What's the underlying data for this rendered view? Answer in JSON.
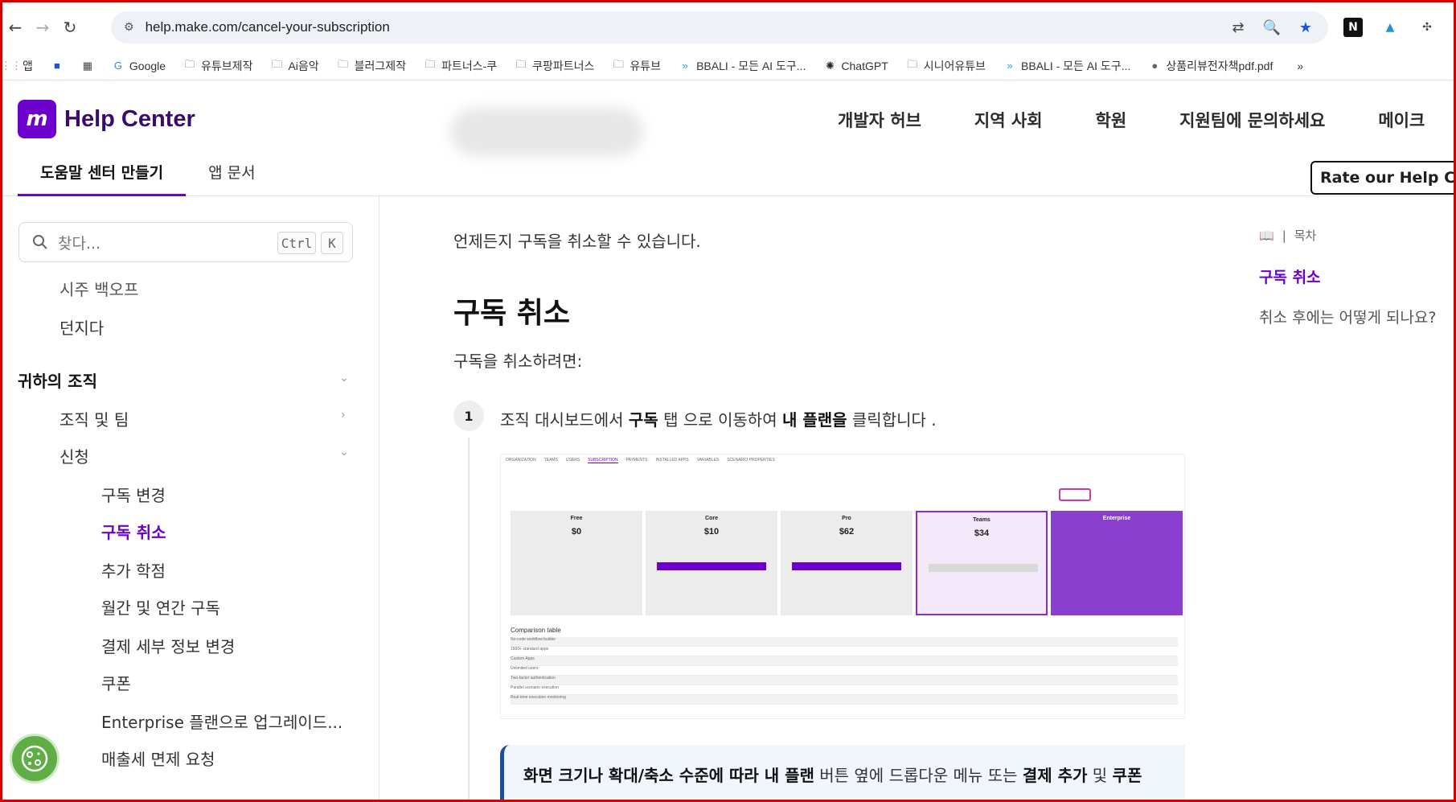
{
  "browser": {
    "url": "help.make.com/cancel-your-subscription",
    "bookmarks": [
      {
        "label": "앱",
        "icon": "apps-grid-icon"
      },
      {
        "label": "",
        "icon": "blue-square-icon"
      },
      {
        "label": "",
        "icon": "grid-icon"
      },
      {
        "label": "Google",
        "icon": "google-icon"
      },
      {
        "label": "유튜브제작",
        "icon": "folder-icon"
      },
      {
        "label": "Ai음악",
        "icon": "folder-icon"
      },
      {
        "label": "블러그제작",
        "icon": "folder-icon"
      },
      {
        "label": "파트너스-쿠",
        "icon": "folder-icon"
      },
      {
        "label": "쿠팡파트너스",
        "icon": "folder-icon"
      },
      {
        "label": "유튜브",
        "icon": "folder-icon"
      },
      {
        "label": "BBALI - 모든 AI 도구...",
        "icon": "bbali-icon"
      },
      {
        "label": "ChatGPT",
        "icon": "openai-icon"
      },
      {
        "label": "시니어유튜브",
        "icon": "folder-icon"
      },
      {
        "label": "BBALI - 모든 AI 도구...",
        "icon": "bbali-icon"
      },
      {
        "label": "상품리뷰전자책pdf.pdf",
        "icon": "globe-icon"
      }
    ],
    "more_bookmarks": "»"
  },
  "header": {
    "logo_text": "Help Center",
    "nav": [
      "개발자 허브",
      "지역 사회",
      "학원",
      "지원팀에 문의하세요",
      "메이크"
    ],
    "tabs": [
      "도움말 센터 만들기",
      "앱 문서"
    ],
    "rate_button": "Rate our Help Center"
  },
  "sidebar": {
    "search_placeholder": "찾다...",
    "shortcut_ctrl": "Ctrl",
    "shortcut_k": "K",
    "items": {
      "partial_top": "시주 백오프",
      "throw": "던지다",
      "org_section": "귀하의 조직",
      "org_team": "조직 및 팀",
      "subscription": "신청",
      "change_sub": "구독 변경",
      "cancel_sub": "구독 취소",
      "extra_credit": "추가 학점",
      "monthly_yearly": "월간 및 연간 구독",
      "change_payment": "결제 세부 정보 변경",
      "coupon": "쿠폰",
      "enterprise_upgrade": "Enterprise 플랜으로 업그레이드...",
      "tax_exempt": "매출세 면제 요청"
    }
  },
  "main": {
    "intro": "언제든지 구독을 취소할 수 있습니다.",
    "heading": "구독 취소",
    "lead": "구독을 취소하려면:",
    "step_number": "1",
    "step_pre": "조직 대시보드에서 ",
    "step_b1": "구독",
    "step_mid": " 탭 으로 이동하여 ",
    "step_b2": "내 플랜을",
    "step_post": " 클릭합니다 .",
    "screenshot": {
      "tabs": [
        "ORGANIZATION",
        "TEAMS",
        "USERS",
        "SUBSCRIPTION",
        "PAYMENTS",
        "INSTALLED APPS",
        "VARIABLES",
        "SCENARIO PROPERTIES"
      ],
      "plans": [
        {
          "name": "Free",
          "price": "$0"
        },
        {
          "name": "Core",
          "price": "$10"
        },
        {
          "name": "Pro",
          "price": "$62"
        },
        {
          "name": "Teams",
          "price": "$34"
        },
        {
          "name": "Enterprise",
          "price": ""
        }
      ],
      "comparison_title": "Comparison table",
      "comparison_rows": [
        "No-code workflow builder",
        "1500+ standard apps",
        "Custom Apps",
        "Unlimited users",
        "Two-factor authentication",
        "Parallel scenario execution",
        "Real-time execution monitoring"
      ]
    },
    "note_b1": "화면 크기나 확대/축소 수준에 따라 내 플랜",
    "note_mid": " 버튼 옆에 드롭다운 메뉴 또는 ",
    "note_b2": "결제 추가",
    "note_and": " 및 ",
    "note_b3": "쿠폰"
  },
  "toc": {
    "label": "목차",
    "items": [
      "구독 취소",
      "취소 후에는 어떻게 되나요?"
    ]
  },
  "colors": {
    "brand": "#6d00cc",
    "note_border": "#1d4f9f",
    "frame": "#d40000"
  }
}
